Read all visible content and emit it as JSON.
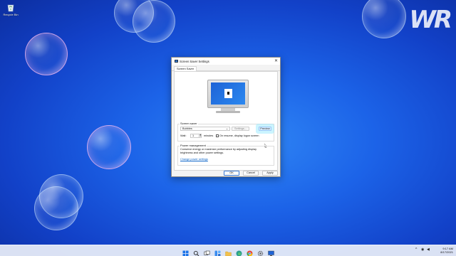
{
  "desktop": {
    "recycle_bin_label": "Recycle Bin",
    "watermark": "WR"
  },
  "dialog": {
    "title": "Screen Saver Settings",
    "close_glyph": "✕",
    "tab_label": "Screen Saver",
    "screen_saver_group_label": "Screen saver",
    "selected_screensaver": "Bubbles",
    "settings_button": "Settings...",
    "preview_button": "Preview",
    "wait_label": "Wait:",
    "wait_value": "1",
    "minutes_label": "minutes",
    "resume_checkbox_label": "On resume, display logon screen",
    "resume_checked": false,
    "power_group_label": "Power management",
    "power_description": "Conserve energy or maximize performance by adjusting display brightness and other power settings.",
    "power_link": "Change power settings",
    "ok_button": "OK",
    "cancel_button": "Cancel",
    "apply_button": "Apply"
  },
  "taskbar": {
    "icons": [
      "windows-start-icon",
      "search-icon",
      "task-view-icon",
      "widgets-icon",
      "file-explorer-icon",
      "edge-icon",
      "chrome-icon",
      "settings-icon",
      "screen-saver-settings-icon"
    ],
    "time": "9:17 AM",
    "date": "8/17/2021",
    "tray_chevron": "^",
    "tray_network": "◉",
    "tray_volume": "◀"
  },
  "colors": {
    "accent": "#0a64c8",
    "desktop": "#1c63e8"
  }
}
